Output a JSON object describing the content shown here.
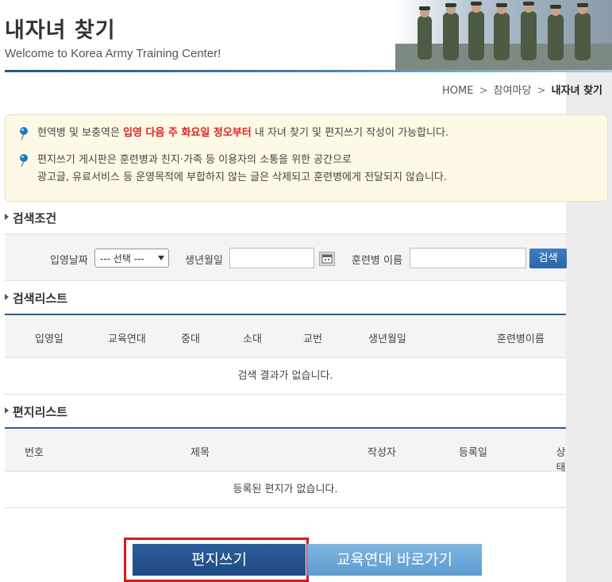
{
  "header": {
    "title": "내자녀 찾기",
    "subtitle": "Welcome to Korea Army Training Center!"
  },
  "breadcrumb": {
    "home": "HOME",
    "sep": ">",
    "parent": "참여마당",
    "current": "내자녀 찾기"
  },
  "notice": {
    "line1_pre": "현역병 및 보충역은 ",
    "line1_highlight": "입영 다음 주 화요일 정오부터",
    "line1_post": " 내 자녀 찾기 및 편지쓰기 작성이 가능합니다.",
    "line2a": "편지쓰기 게시판은 훈련병과 친지·가족 등 이용자의 소통을 위한 공간으로",
    "line2b": "광고글, 유료서비스 등 운영목적에 부합하지 않는 글은 삭제되고 훈련병에게 전달되지 않습니다."
  },
  "search": {
    "section_title": "검색조건",
    "enlist_date_label": "입영날짜",
    "enlist_date_selected": "--- 선택 ---",
    "birth_label": "생년월일",
    "birth_value": "",
    "name_label": "훈련병 이름",
    "name_value": "",
    "search_button": "검색"
  },
  "result_list": {
    "section_title": "검색리스트",
    "columns": [
      "입영일",
      "교육연대",
      "중대",
      "소대",
      "교번",
      "생년월일",
      "훈련병이름"
    ],
    "empty_message": "검색 결과가 없습니다."
  },
  "letter_list": {
    "section_title": "편지리스트",
    "columns": [
      "번호",
      "제목",
      "작성자",
      "등록일",
      "상태"
    ],
    "empty_message": "등록된 편지가 없습니다."
  },
  "buttons": {
    "write_letter": "편지쓰기",
    "go_regiment": "교육연대 바로가기"
  },
  "colors": {
    "accent_blue": "#2b5f93",
    "highlight_red": "#e22020",
    "focus_outline": "#e0161f"
  }
}
